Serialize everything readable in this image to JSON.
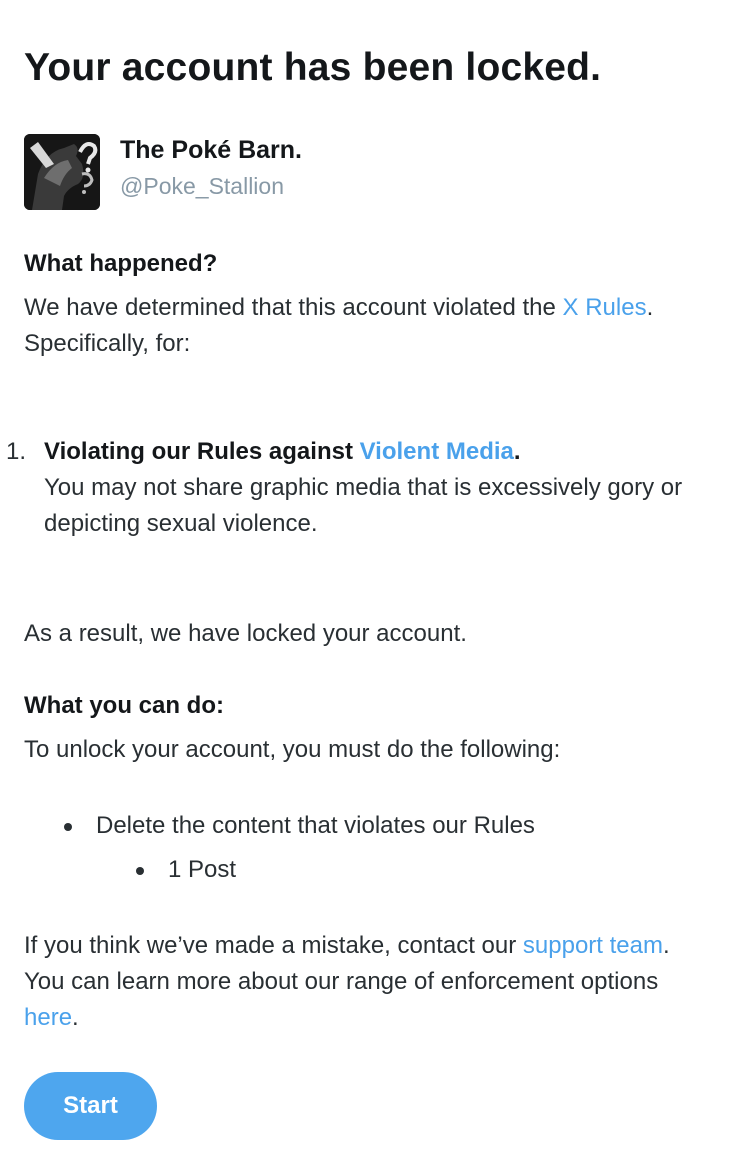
{
  "title": "Your account has been locked.",
  "account": {
    "display_name": "The Poké Barn.",
    "handle": "@Poke_Stallion"
  },
  "what_happened": {
    "heading": "What happened?",
    "text_before": "We have determined that this account violated the ",
    "rules_link": "X Rules",
    "text_after": ". Specifically, for:"
  },
  "violations": [
    {
      "number": "1.",
      "title_before": "Violating our Rules against ",
      "title_link": "Violent Media",
      "title_after": ".",
      "description": "You may not share graphic media that is excessively gory or depicting sexual violence."
    }
  ],
  "result_text": "As a result, we have locked your account.",
  "what_you_can_do": {
    "heading": "What you can do:",
    "intro": "To unlock your account, you must do the following:",
    "steps": [
      {
        "label": "Delete the content that violates our Rules",
        "subitems": [
          "1 Post"
        ]
      }
    ]
  },
  "mistake": {
    "text1": "If you think we’ve made a mistake, contact our ",
    "support_link": "support team",
    "text2": ". You can learn more about our range of enforcement options ",
    "here_link": "here",
    "text3": "."
  },
  "start_button": "Start",
  "colors": {
    "link": "#4aa1eb",
    "button": "#4ea6ee",
    "text": "#292f33",
    "muted": "#8899a6"
  }
}
